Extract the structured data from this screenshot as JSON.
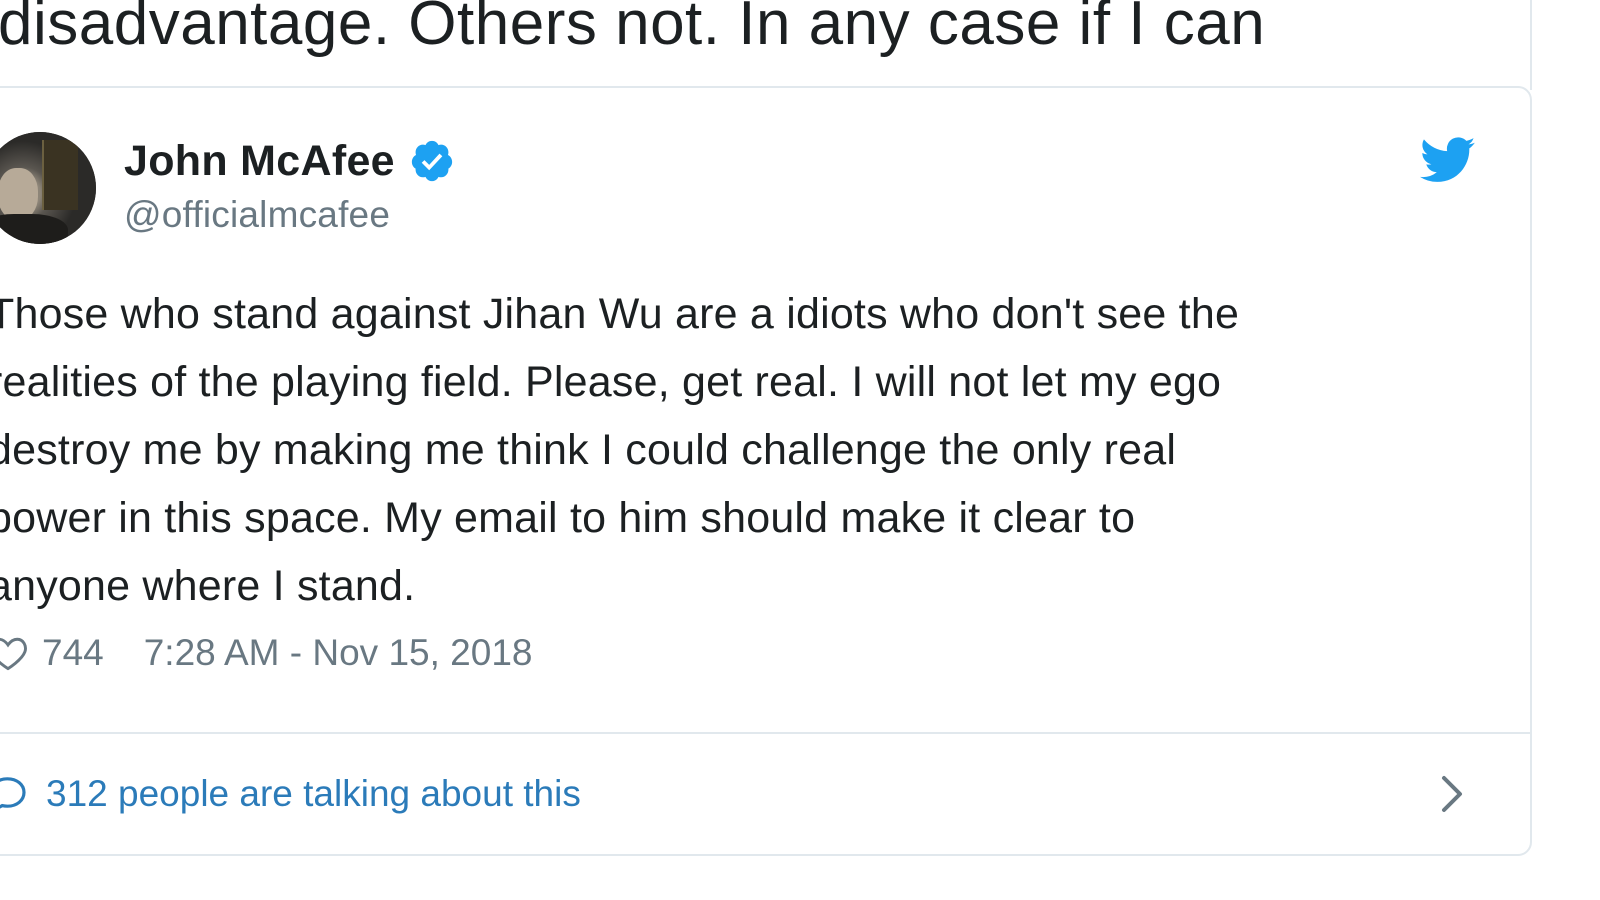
{
  "previous_tweet": {
    "text_line": "disadvantage. Others not. In any case if I can",
    "text_line_partial": "                                               "
  },
  "author": {
    "name": "John McAfee",
    "handle": "@officialmcafee",
    "verified": true
  },
  "tweet": {
    "text": "Those who stand against Jihan Wu are a idiots who don't see the realities of the playing field. Please, get real. I will not let my ego destroy me by making me think I could challenge the only real power in this space. My email to him should make it clear to anyone where I stand.",
    "lines": [
      "Those who stand against Jihan Wu are a idiots who don't see the",
      "realities of the playing field. Please, get real. I will not let my ego",
      "destroy me by making me think I could challenge the only real",
      "power in this space. My email to him should make it clear to",
      "anyone where I stand."
    ],
    "likes": "744",
    "timestamp": "7:28 AM - Nov 15, 2018"
  },
  "footer": {
    "talking_label": "312 people are talking about this"
  },
  "icons": {
    "verified": "verified-badge-icon",
    "bird": "twitter-bird-icon",
    "heart": "heart-icon",
    "bubble": "speech-bubble-icon",
    "chevron": "chevron-right-icon"
  },
  "colors": {
    "text": "#1c2022",
    "muted": "#697882",
    "link": "#2b7bb9",
    "twitter_blue": "#1da1f2",
    "border": "#e1e8ed"
  }
}
